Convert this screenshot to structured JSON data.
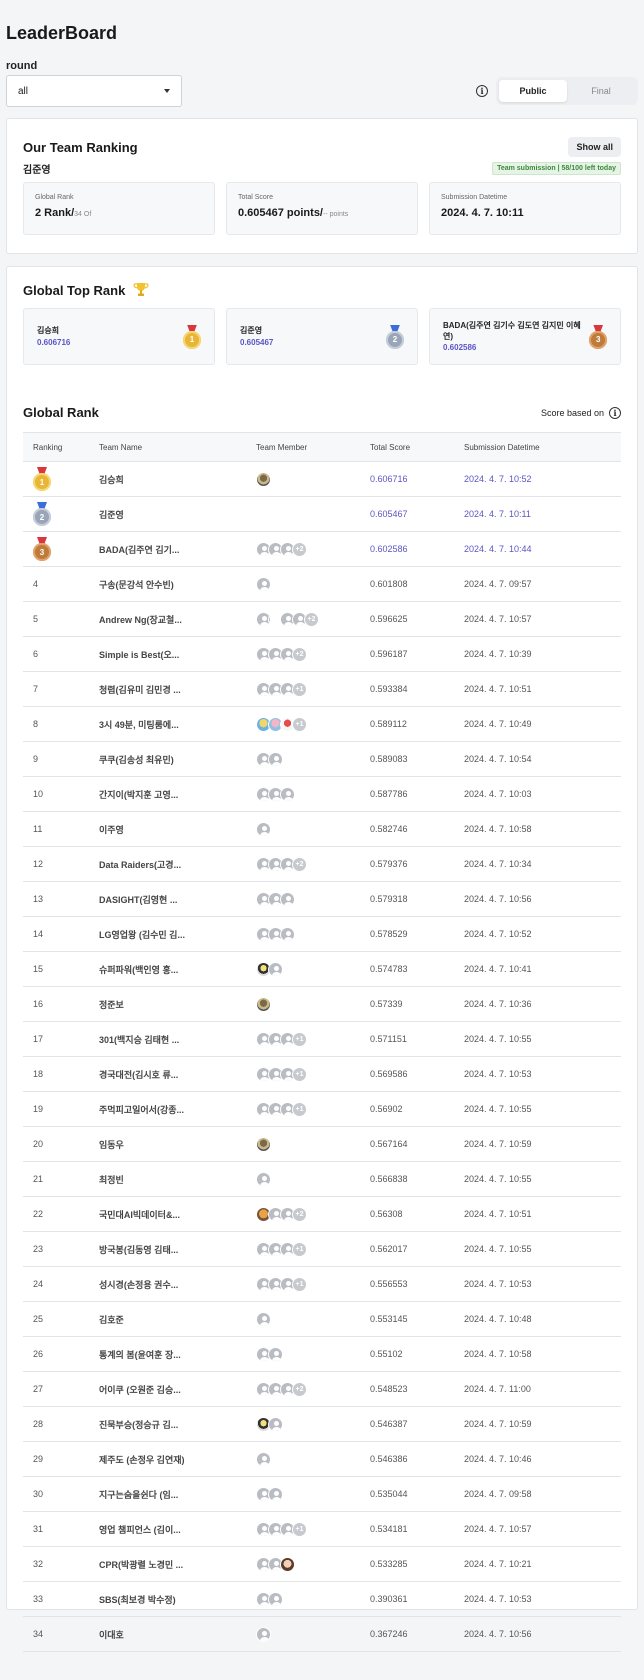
{
  "page_title": "LeaderBoard",
  "round": {
    "label": "round",
    "value": "all"
  },
  "toggle": {
    "public": "Public",
    "final": "Final"
  },
  "team_ranking": {
    "title": "Our Team Ranking",
    "show_all": "Show all",
    "team_name": "김준영",
    "quota": "Team submission | 58/100 left today",
    "global_rank_label": "Global Rank",
    "global_rank_value": "2 Rank/",
    "global_rank_of": "34 Of",
    "total_score_label": "Total Score",
    "total_score_value": "0.605467 points/",
    "total_score_suffix": "-- points",
    "datetime_label": "Submission Datetime",
    "datetime_value": "2024. 4. 7. 10:11"
  },
  "top_rank": {
    "title": "Global Top Rank",
    "items": [
      {
        "name": "김승희",
        "score": "0.606716",
        "medal": "1"
      },
      {
        "name": "김준영",
        "score": "0.605467",
        "medal": "2"
      },
      {
        "name": "BADA(김주연 김기수 김도연 김지민 이혜연)",
        "score": "0.602586",
        "medal": "3"
      }
    ]
  },
  "global_rank": {
    "title": "Global Rank",
    "score_based": "Score based on",
    "columns": [
      "Ranking",
      "Team Name",
      "Team Member",
      "Total Score",
      "Submission Datetime"
    ],
    "rows": [
      {
        "rank": "1",
        "name": "김승희",
        "score": "0.606716",
        "datetime": "2024. 4. 7. 10:52",
        "members": "img",
        "more": ""
      },
      {
        "rank": "2",
        "name": "김준영",
        "score": "0.605467",
        "datetime": "2024. 4. 7. 10:11",
        "members": "none",
        "more": ""
      },
      {
        "rank": "3",
        "name": "BADA(김주연 김기...",
        "score": "0.602586",
        "datetime": "2024. 4. 7. 10:44",
        "members": "3",
        "more": "+2"
      },
      {
        "rank": "4",
        "name": "구송(문강석 안수빈)",
        "score": "0.601808",
        "datetime": "2024. 4. 7. 09:57",
        "members": "1",
        "more": ""
      },
      {
        "rank": "5",
        "name": "Andrew Ng(장교철...",
        "score": "0.596625",
        "datetime": "2024. 4. 7. 10:57",
        "members": "gap",
        "more": "+2"
      },
      {
        "rank": "6",
        "name": "Simple is Best(오...",
        "score": "0.596187",
        "datetime": "2024. 4. 7. 10:39",
        "members": "3",
        "more": "+2"
      },
      {
        "rank": "7",
        "name": "청렴(김유미 김민경 ...",
        "score": "0.593384",
        "datetime": "2024. 4. 7. 10:51",
        "members": "3",
        "more": "+1"
      },
      {
        "rank": "8",
        "name": "3시 49분, 미팅룸에...",
        "score": "0.589112",
        "datetime": "2024. 4. 7. 10:49",
        "members": "img3",
        "more": "+1"
      },
      {
        "rank": "9",
        "name": "쿠쿠(김송성 최유민)",
        "score": "0.589083",
        "datetime": "2024. 4. 7. 10:54",
        "members": "2",
        "more": ""
      },
      {
        "rank": "10",
        "name": "간지이(박지훈 고영...",
        "score": "0.587786",
        "datetime": "2024. 4. 7. 10:03",
        "members": "3",
        "more": ""
      },
      {
        "rank": "11",
        "name": "이주영",
        "score": "0.582746",
        "datetime": "2024. 4. 7. 10:58",
        "members": "1",
        "more": ""
      },
      {
        "rank": "12",
        "name": "Data Raiders(고경...",
        "score": "0.579376",
        "datetime": "2024. 4. 7. 10:34",
        "members": "3",
        "more": "+2"
      },
      {
        "rank": "13",
        "name": "DASIGHT(김영현 ...",
        "score": "0.579318",
        "datetime": "2024. 4. 7. 10:56",
        "members": "3",
        "more": ""
      },
      {
        "rank": "14",
        "name": "LG영업왕 (김수민 김...",
        "score": "0.578529",
        "datetime": "2024. 4. 7. 10:52",
        "members": "3",
        "more": ""
      },
      {
        "rank": "15",
        "name": "슈퍼파워(백인영 홍...",
        "score": "0.574783",
        "datetime": "2024. 4. 7. 10:41",
        "members": "img1",
        "more": ""
      },
      {
        "rank": "16",
        "name": "정준보",
        "score": "0.57339",
        "datetime": "2024. 4. 7. 10:36",
        "members": "img",
        "more": ""
      },
      {
        "rank": "17",
        "name": "301(백지승 김태현 ...",
        "score": "0.571151",
        "datetime": "2024. 4. 7. 10:55",
        "members": "3",
        "more": "+1"
      },
      {
        "rank": "18",
        "name": "경국대전(김시호 류...",
        "score": "0.569586",
        "datetime": "2024. 4. 7. 10:53",
        "members": "3",
        "more": "+1"
      },
      {
        "rank": "19",
        "name": "주먹피고일어서(강종...",
        "score": "0.56902",
        "datetime": "2024. 4. 7. 10:55",
        "members": "3",
        "more": "+1"
      },
      {
        "rank": "20",
        "name": "임동우",
        "score": "0.567164",
        "datetime": "2024. 4. 7. 10:59",
        "members": "img",
        "more": ""
      },
      {
        "rank": "21",
        "name": "최정빈",
        "score": "0.566838",
        "datetime": "2024. 4. 7. 10:55",
        "members": "1",
        "more": ""
      },
      {
        "rank": "22",
        "name": "국민대AI빅데이터&...",
        "score": "0.56308",
        "datetime": "2024. 4. 7. 10:51",
        "members": "img2",
        "more": "+2"
      },
      {
        "rank": "23",
        "name": "방국봉(김동영 김태...",
        "score": "0.562017",
        "datetime": "2024. 4. 7. 10:55",
        "members": "3",
        "more": "+1"
      },
      {
        "rank": "24",
        "name": "성시경(손정용 권수...",
        "score": "0.556553",
        "datetime": "2024. 4. 7. 10:53",
        "members": "3",
        "more": "+1"
      },
      {
        "rank": "25",
        "name": "김호준",
        "score": "0.553145",
        "datetime": "2024. 4. 7. 10:48",
        "members": "1",
        "more": ""
      },
      {
        "rank": "26",
        "name": "통계의 봄(윤여훈 장...",
        "score": "0.55102",
        "datetime": "2024. 4. 7. 10:58",
        "members": "2",
        "more": ""
      },
      {
        "rank": "27",
        "name": "어이쿠 (오원준 김승...",
        "score": "0.548523",
        "datetime": "2024. 4. 7. 11:00",
        "members": "3",
        "more": "+2"
      },
      {
        "rank": "28",
        "name": "진묵부승(정승규 김...",
        "score": "0.546387",
        "datetime": "2024. 4. 7. 10:59",
        "members": "img1",
        "more": ""
      },
      {
        "rank": "29",
        "name": "제주도 (손정우 김연재)",
        "score": "0.546386",
        "datetime": "2024. 4. 7. 10:46",
        "members": "1",
        "more": ""
      },
      {
        "rank": "30",
        "name": "지구는숨을쉰다 (임...",
        "score": "0.535044",
        "datetime": "2024. 4. 7. 09:58",
        "members": "2",
        "more": ""
      },
      {
        "rank": "31",
        "name": "영업 챔피언스 (김이...",
        "score": "0.534181",
        "datetime": "2024. 4. 7. 10:57",
        "members": "3",
        "more": "+1"
      },
      {
        "rank": "32",
        "name": "CPR(박광렬 노경민 ...",
        "score": "0.533285",
        "datetime": "2024. 4. 7. 10:21",
        "members": "2img",
        "more": ""
      },
      {
        "rank": "33",
        "name": "SBS(최보경 박수정)",
        "score": "0.390361",
        "datetime": "2024. 4. 7. 10:53",
        "members": "2",
        "more": ""
      },
      {
        "rank": "34",
        "name": "이대호",
        "score": "0.367246",
        "datetime": "2024. 4. 7. 10:56",
        "members": "1",
        "more": ""
      }
    ]
  },
  "colors": {
    "accent": "#5a56c4",
    "quota_green": "#3b8a3b",
    "gold": "#e9b535",
    "silver": "#9aa6b8",
    "bronze": "#c07a3a"
  },
  "icons": {
    "info": "info-icon",
    "trophy": "trophy-icon",
    "dropdown": "chevron-down-icon",
    "avatar": "user-avatar-icon"
  }
}
